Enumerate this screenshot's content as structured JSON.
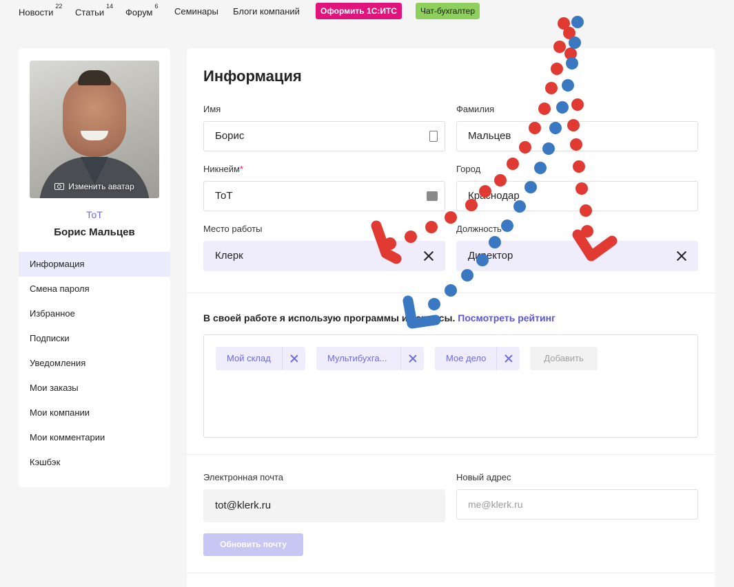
{
  "nav": {
    "items": [
      {
        "label": "Новости",
        "count": "22"
      },
      {
        "label": "Статьи",
        "count": "14"
      },
      {
        "label": "Форум",
        "count": "6"
      },
      {
        "label": "Семинары",
        "count": ""
      },
      {
        "label": "Блоги компаний",
        "count": ""
      }
    ],
    "its_label": "Оформить 1С:ИТС",
    "chat_label": "Чат-бухгалтер"
  },
  "profile": {
    "change_avatar": "Изменить аватар",
    "nickname": "ТоТ",
    "full_name": "Борис Мальцев"
  },
  "menu": [
    "Информация",
    "Смена пароля",
    "Избранное",
    "Подписки",
    "Уведомления",
    "Мои заказы",
    "Мои компании",
    "Мои комментарии",
    "Кэшбэк"
  ],
  "info": {
    "title": "Информация",
    "first_name_label": "Имя",
    "first_name": "Борис",
    "last_name_label": "Фамилия",
    "last_name": "Мальцев",
    "nickname_label": "Никнейм",
    "required_mark": "*",
    "nickname": "ТоТ",
    "city_label": "Город",
    "city": "Краснодар",
    "workplace_label": "Место работы",
    "workplace": "Клерк",
    "position_label": "Должность",
    "position": "Директор"
  },
  "programs": {
    "title": "В своей работе я использую программы и сервисы.",
    "rating_link": "Посмотреть рейтинг",
    "tags": [
      "Мой склад",
      "Мультибухга...",
      "Мое дело"
    ],
    "add_label": "Добавить"
  },
  "email": {
    "email_label": "Электронная почта",
    "email": "tot@klerk.ru",
    "new_label": "Новый адрес",
    "new_placeholder": "me@klerk.ru",
    "update_button": "Обновить почту"
  },
  "colors": {
    "accent": "#6e6ae0",
    "its": "#e0147c",
    "chat": "#8fcf5e",
    "doodle_red": "#e03a33",
    "doodle_blue": "#3a78c2"
  }
}
